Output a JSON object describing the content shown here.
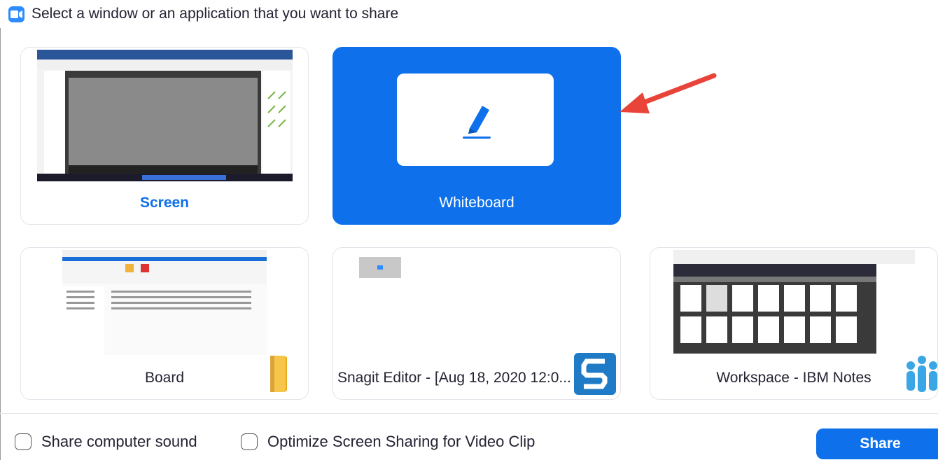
{
  "window": {
    "title": "Select a window or an application that you want to share"
  },
  "tiles": [
    {
      "label": "Screen",
      "icon": "desktop-screenshot-thumbnail"
    },
    {
      "label": "Whiteboard",
      "icon": "pen-icon",
      "selected": true
    },
    {
      "label": "Board",
      "icon": "folder-icon"
    },
    {
      "label": "Snagit Editor - [Aug 18, 2020 12:0...",
      "icon": "snagit-icon"
    },
    {
      "label": "Workspace - IBM Notes",
      "icon": "ibm-notes-icon"
    }
  ],
  "options": {
    "share_sound": "Share computer sound",
    "optimize_video": "Optimize Screen Sharing for Video Clip"
  },
  "share_button": "Share",
  "colors": {
    "accent": "#0E71EB",
    "annotation_arrow": "#E8443A",
    "folder": "#F5C64A",
    "snagit": "#1F7BC6",
    "ibm_notes": "#3BA6E5"
  }
}
